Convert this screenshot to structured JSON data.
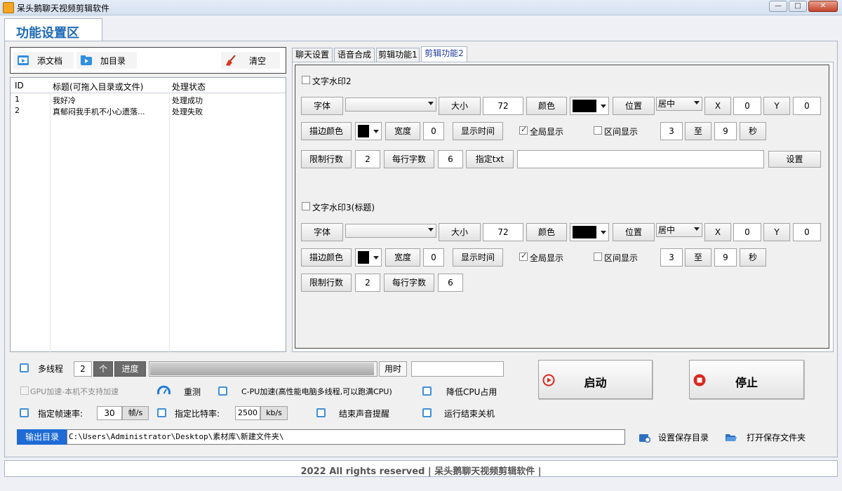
{
  "window": {
    "title": "呆头鹅聊天视频剪辑软件",
    "min": "—",
    "max": "□",
    "close": "✕"
  },
  "main_tab": "功能设置区",
  "toolbar": {
    "add_doc": "添文档",
    "add_dir": "加目录",
    "clear": "清空"
  },
  "list": {
    "headers": {
      "id": "ID",
      "title": "标题(可拖入目录或文件)",
      "status": "处理状态"
    },
    "rows": [
      {
        "id": "1",
        "title": "我好冷",
        "status": "处理成功"
      },
      {
        "id": "2",
        "title": "真郁闷我手机不小心遗落...",
        "status": "处理失败"
      }
    ]
  },
  "tabs": [
    {
      "label": "聊天设置"
    },
    {
      "label": "语音合成"
    },
    {
      "label": "剪辑功能1"
    },
    {
      "label": "剪辑功能2",
      "active": true
    }
  ],
  "wm2": {
    "checkbox": "文字水印2",
    "font": "字体",
    "size_label": "大小",
    "size": "72",
    "color_label": "颜色",
    "pos_label": "位置",
    "pos": "居中",
    "x_label": "X",
    "x": "0",
    "y_label": "Y",
    "y": "0",
    "stroke_color": "描边颜色",
    "width_label": "宽度",
    "width": "0",
    "show_time": "显示时间",
    "global": "全局显示",
    "range": "区间显示",
    "from": "3",
    "to_label": "至",
    "to": "9",
    "sec": "秒",
    "limit_lines": "限制行数",
    "lines": "2",
    "chars_label": "每行字数",
    "chars": "6",
    "txt_label": "指定txt",
    "txt_value": "",
    "set_button": "设置"
  },
  "wm3": {
    "checkbox": "文字水印3(标题)",
    "font": "字体",
    "size_label": "大小",
    "size": "72",
    "color_label": "颜色",
    "pos_label": "位置",
    "pos": "居中",
    "x_label": "X",
    "x": "0",
    "y_label": "Y",
    "y": "0",
    "stroke_color": "描边颜色",
    "width_label": "宽度",
    "width": "0",
    "show_time": "显示时间",
    "global": "全局显示",
    "range": "区间显示",
    "from": "3",
    "to_label": "至",
    "to": "9",
    "sec": "秒",
    "limit_lines": "限制行数",
    "lines": "2",
    "chars_label": "每行字数",
    "chars": "6"
  },
  "bottom": {
    "multithread": "多线程",
    "threads": "2",
    "unit": "个",
    "progress_label": "进度",
    "progress": 0.99,
    "elapsed_label": "用时",
    "elapsed": "",
    "start": "启动",
    "stop": "停止",
    "gpu": "GPU加速-本机不支持加速",
    "retest": "重测",
    "cpu": "C-PU加速(高性能电脑多线程,可以跑满CPU)",
    "lower_cpu": "降低CPU占用",
    "fps_label": "指定帧速率:",
    "fps": "30",
    "fps_unit": "帧/s",
    "bitrate_label": "指定比特率:",
    "bitrate": "2500",
    "bitrate_unit": "kb/s",
    "sound": "结束声音提醒",
    "shutdown": "运行结束关机",
    "output_label": "输出目录",
    "output_path": "C:\\Users\\Administrator\\Desktop\\素材库\\新建文件夹\\",
    "set_dir": "设置保存目录",
    "open_dir": "打开保存文件夹"
  },
  "footer": "2022 All rights reserved | 呆头鹅聊天视频剪辑软件 |",
  "colors": {
    "accent": "#1e6bd6",
    "tab_title": "#1e6bb8",
    "checkbox_blue": "#3f8fd8",
    "start_red": "#d9281e"
  }
}
